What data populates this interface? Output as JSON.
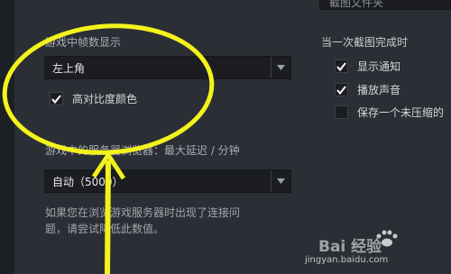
{
  "top_field": {
    "value": "截图文件夹"
  },
  "fps": {
    "label": "游戏中帧数显示",
    "selected": "左上角",
    "high_contrast": {
      "label": "高对比度颜色",
      "checked": true
    }
  },
  "screenshot": {
    "label": "当一次截图完成时",
    "options": [
      {
        "label": "显示通知",
        "checked": true
      },
      {
        "label": "播放声音",
        "checked": true
      },
      {
        "label": "保存一个未压缩的",
        "checked": false
      }
    ]
  },
  "server_browser": {
    "label": "游戏中的服务器浏览器：最大延迟 / 分钟",
    "selected": "自动（5000）",
    "note_line1": "如果您在浏览游戏服务器时出现了连接问",
    "note_line2": "题，请尝试降低此数值。"
  },
  "watermark": {
    "brand": "Bai 经验",
    "url": "jingyan.baidu.com"
  },
  "colors": {
    "annotation": "#f4f21c",
    "background": "#2b2f35"
  }
}
